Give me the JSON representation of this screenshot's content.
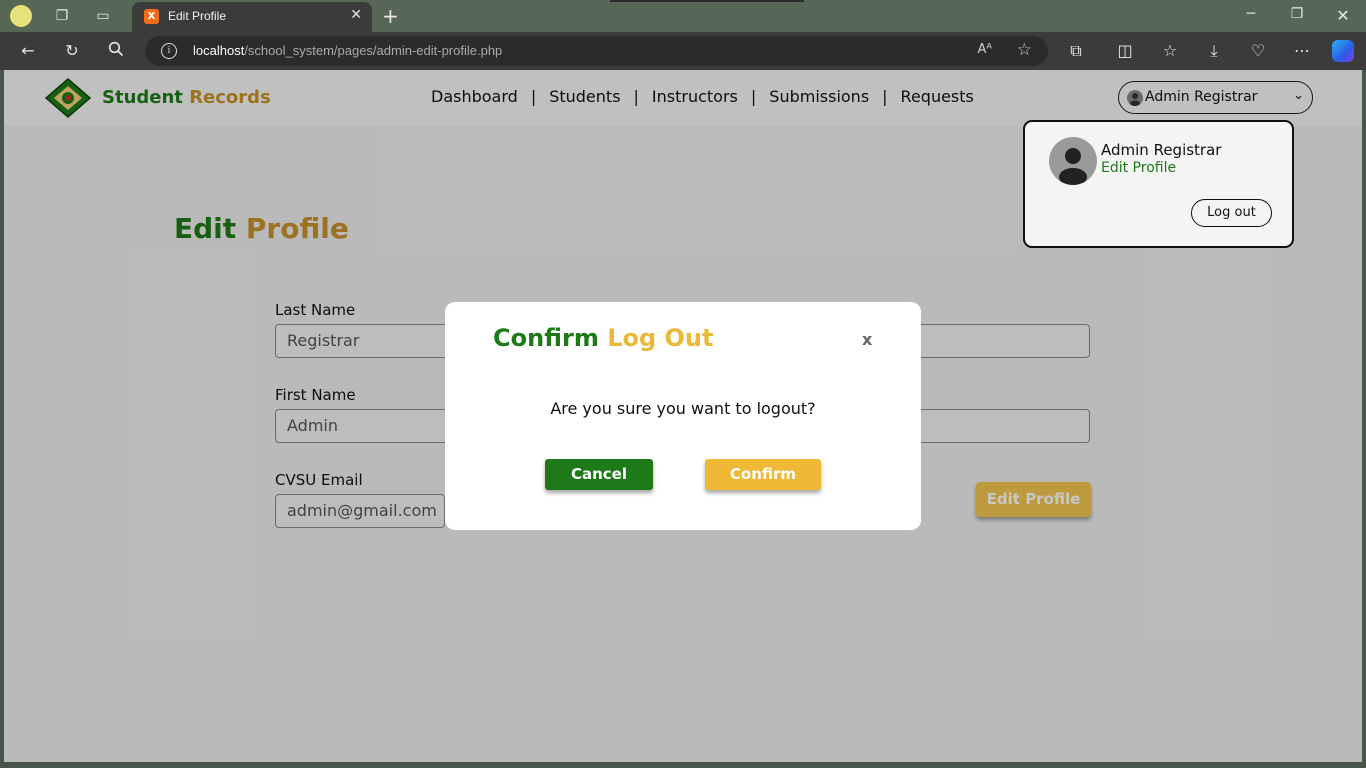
{
  "browser": {
    "tab_title": "Edit Profile",
    "tab_close": "✕",
    "new_tab": "+",
    "url_host": "localhost",
    "url_path": "/school_system/pages/admin-edit-profile.php",
    "read_aloud": "Aᴬ"
  },
  "nav": {
    "brand_green": "Student",
    "brand_gold": "Records",
    "links": [
      "Dashboard",
      "Students",
      "Instructors",
      "Submissions",
      "Requests"
    ],
    "separator": "|",
    "user_label": "Admin Registrar"
  },
  "page": {
    "title_green": "Edit",
    "title_gold": "Profile",
    "last_name_label": "Last Name",
    "last_name_value": "Registrar",
    "first_name_label": "First Name",
    "first_name_value": "Admin",
    "email_label": "CVSU Email",
    "email_value": "admin@gmail.com",
    "edit_button": "Edit Profile"
  },
  "user_menu": {
    "name": "Admin Registrar",
    "edit_profile": "Edit Profile",
    "logout": "Log out"
  },
  "modal": {
    "title_green": "Confirm",
    "title_gold": "Log Out",
    "close": "x",
    "message": "Are you sure you want to logout?",
    "cancel": "Cancel",
    "confirm": "Confirm"
  },
  "colors": {
    "brand_green": "#1e7a18",
    "brand_gold": "#c8932b",
    "confirm_gold": "#efb936"
  }
}
